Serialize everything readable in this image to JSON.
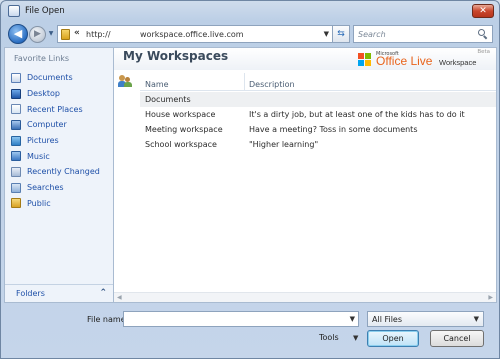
{
  "window": {
    "title": "File Open",
    "close_glyph": "✕"
  },
  "nav": {
    "back_glyph": "◀",
    "forward_glyph": "▶",
    "history_glyph": "▼",
    "address_chevron": "«",
    "address_protocol": "http://",
    "address_url": "workspace.office.live.com",
    "address_dropdown": "▼",
    "refresh_glyph": "⇆",
    "search_placeholder": "Search"
  },
  "sidebar": {
    "header": "Favorite Links",
    "items": [
      {
        "label": "Documents",
        "icon": "documents-icon"
      },
      {
        "label": "Desktop",
        "icon": "desktop-icon"
      },
      {
        "label": "Recent Places",
        "icon": "recent-places-icon"
      },
      {
        "label": "Computer",
        "icon": "computer-icon"
      },
      {
        "label": "Pictures",
        "icon": "pictures-icon"
      },
      {
        "label": "Music",
        "icon": "music-icon"
      },
      {
        "label": "Recently Changed",
        "icon": "recently-changed-icon"
      },
      {
        "label": "Searches",
        "icon": "searches-icon"
      },
      {
        "label": "Public",
        "icon": "public-folder-icon"
      }
    ],
    "folders_label": "Folders",
    "folders_chevron": "⌃"
  },
  "content": {
    "title": "My Workspaces",
    "beta_label": "Beta",
    "logo": {
      "microsoft": "Microsoft",
      "office_live": "Office Live",
      "workspace": "Workspace"
    },
    "columns": {
      "name": "Name",
      "description": "Description"
    },
    "group_label": "Documents",
    "rows": [
      {
        "name": "House workspace",
        "description": "It's a dirty job, but at least one of the kids has to do it"
      },
      {
        "name": "Meeting workspace",
        "description": "Have a meeting? Toss in some documents"
      },
      {
        "name": "School workspace",
        "description": "\"Higher learning\""
      }
    ],
    "scroll_left_glyph": "◀",
    "scroll_right_glyph": "▶"
  },
  "footer": {
    "file_name_label": "File name:",
    "file_name_value": "",
    "file_name_dropdown": "▼",
    "file_type_value": "All Files",
    "file_type_dropdown": "▼",
    "tools_label": "Tools",
    "tools_dropdown": "▼",
    "open_label": "Open",
    "cancel_label": "Cancel"
  },
  "colors": {
    "link_blue": "#1f50a8",
    "open_button_border": "#3c7fb1",
    "office_orange": "#e9641c",
    "close_red": "#c9462c"
  }
}
